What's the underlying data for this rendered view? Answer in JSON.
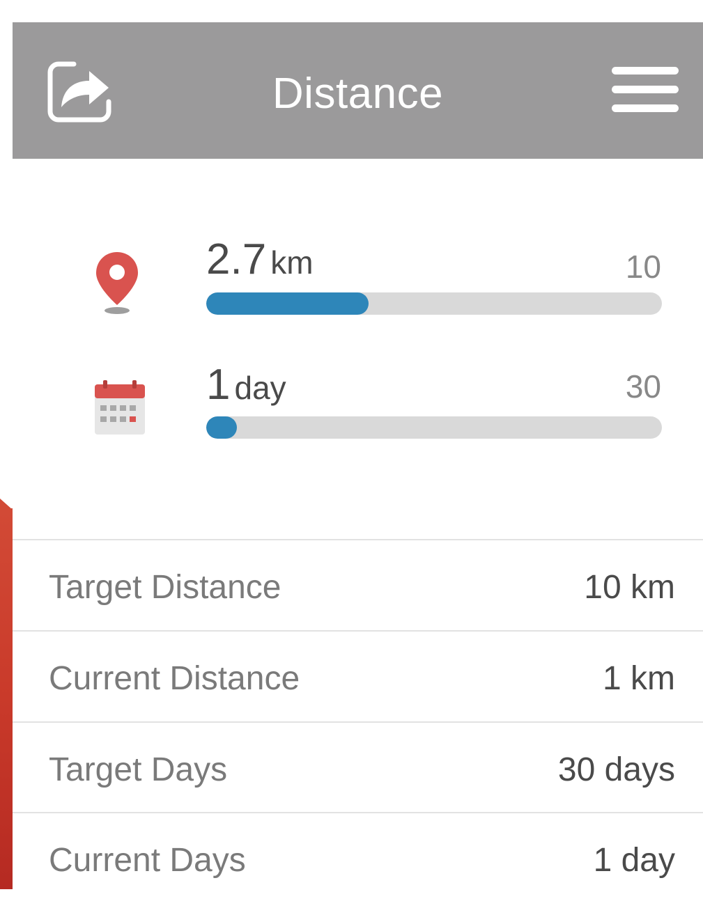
{
  "header": {
    "title": "Distance",
    "share_icon": "share-icon",
    "menu_icon": "menu-icon"
  },
  "progress": {
    "distance": {
      "value": "2.7",
      "unit": "km",
      "max": "10",
      "fraction": 0.27,
      "icon": "location-pin-icon"
    },
    "days": {
      "value": "1",
      "unit": "day",
      "max": "30",
      "fraction": 0.033,
      "icon": "calendar-icon"
    }
  },
  "stats": [
    {
      "label": "Target Distance",
      "value": "10 km"
    },
    {
      "label": "Current Distance",
      "value": "1 km"
    },
    {
      "label": "Target Days",
      "value": "30 days"
    },
    {
      "label": "Current Days",
      "value": "1 day"
    }
  ],
  "colors": {
    "header": "#9b9a9b",
    "accent": "#2e86b9",
    "track": "#d9d9d9",
    "pin": "#d9534f",
    "strip": "#c93a2a"
  }
}
